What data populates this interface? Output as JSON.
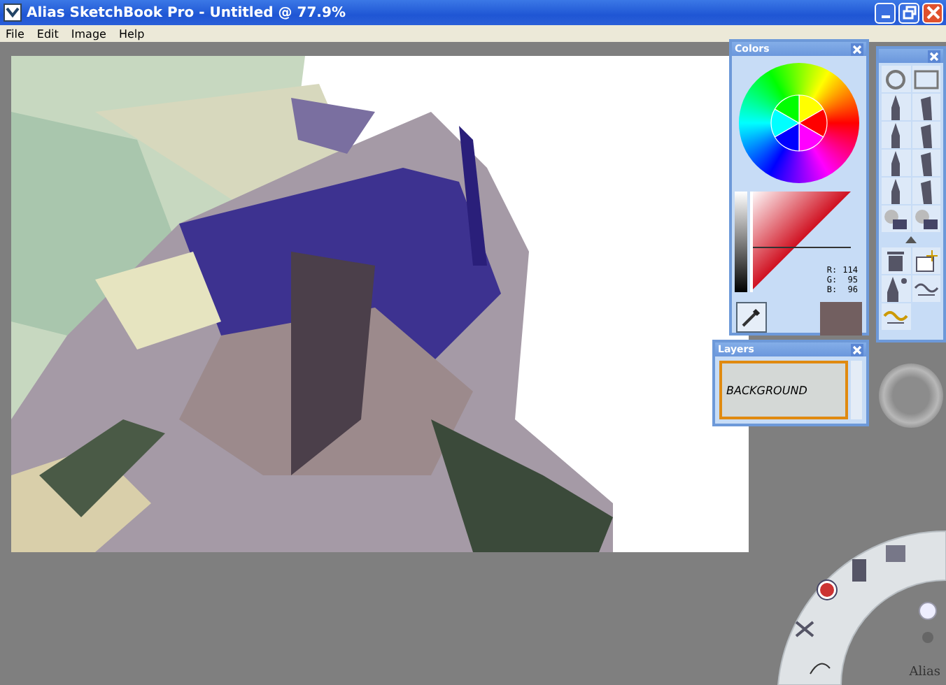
{
  "window": {
    "title": "Alias SketchBook Pro - Untitled @ 77.9%"
  },
  "menu": [
    "File",
    "Edit",
    "Image",
    "Help"
  ],
  "colors_panel": {
    "title": "Colors",
    "color": "#725f60",
    "rgb": [
      {
        "label": "R:",
        "value": "114"
      },
      {
        "label": "G:",
        "value": "95"
      },
      {
        "label": "B:",
        "value": "96"
      }
    ]
  },
  "layers_panel": {
    "title": "Layers",
    "layers": [
      {
        "name": "BACKGROUND",
        "selected": true
      }
    ]
  },
  "lagoon": {
    "logo": "Alias"
  }
}
